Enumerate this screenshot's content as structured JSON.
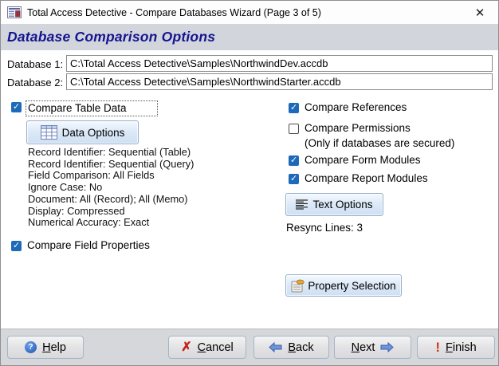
{
  "window": {
    "title": "Total Access Detective - Compare Databases Wizard (Page 3 of 5)",
    "close_glyph": "✕"
  },
  "heading": "Database Comparison Options",
  "databases": {
    "db1_label": "Database 1:",
    "db1_value": "C:\\Total Access Detective\\Samples\\NorthwindDev.accdb",
    "db2_label": "Database 2:",
    "db2_value": "C:\\Total Access Detective\\Samples\\NorthwindStarter.accdb"
  },
  "left": {
    "compare_table_data": {
      "label": "Compare Table Data",
      "checked": true
    },
    "data_options_button": "Data Options",
    "data_summary": [
      "Record Identifier: Sequential (Table)",
      "Record Identifier: Sequential (Query)",
      "Field Comparison: All Fields",
      "Ignore Case: No",
      "Document: All (Record); All (Memo)",
      "Display: Compressed",
      "Numerical Accuracy: Exact"
    ],
    "compare_field_properties": {
      "label": "Compare Field Properties",
      "checked": true
    }
  },
  "right": {
    "compare_references": {
      "label": "Compare References",
      "checked": true
    },
    "compare_permissions": {
      "label": "Compare Permissions",
      "checked": false,
      "note": "(Only if databases are secured)"
    },
    "compare_form_modules": {
      "label": "Compare Form Modules",
      "checked": true
    },
    "compare_report_modules": {
      "label": "Compare Report Modules",
      "checked": true
    },
    "text_options_button": "Text Options",
    "resync_lines": "Resync Lines: 3",
    "property_selection_button": "Property Selection"
  },
  "footer": {
    "help": "Help",
    "help_icon": "?",
    "cancel": "Cancel",
    "cancel_icon": "✗",
    "back": "Back",
    "next": "Next",
    "finish": "Finish",
    "finish_icon": "!"
  }
}
